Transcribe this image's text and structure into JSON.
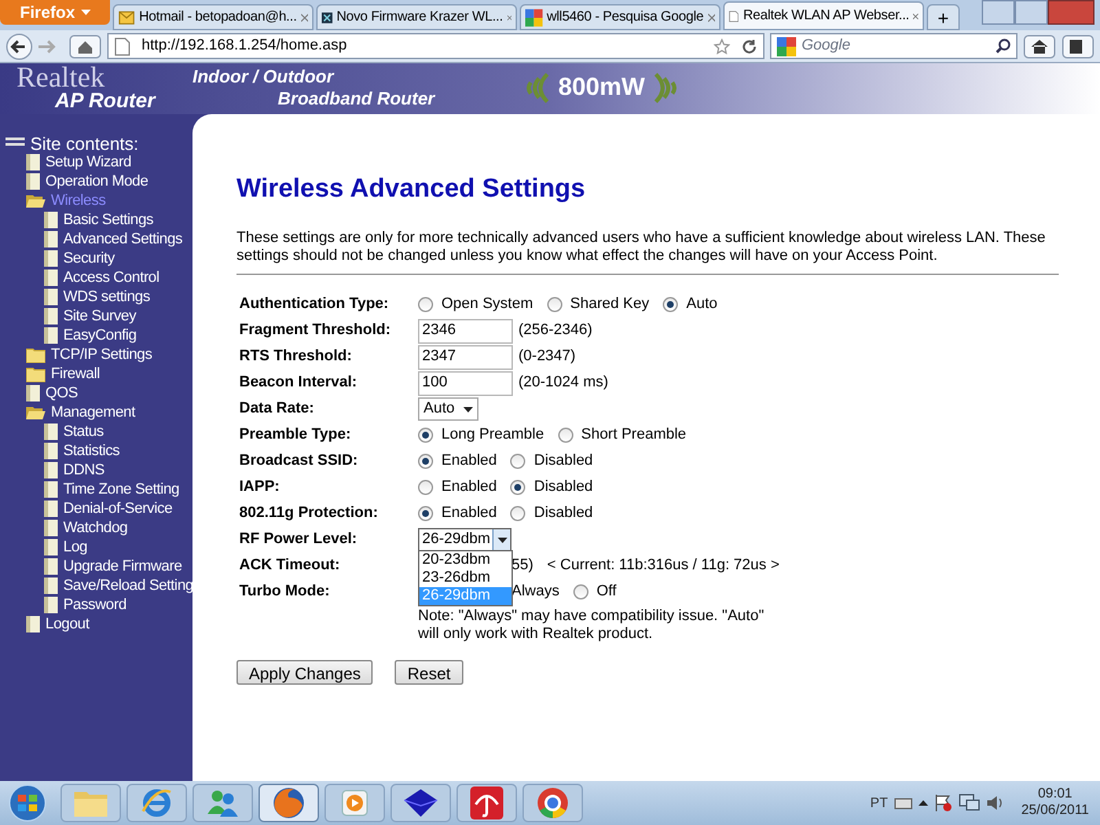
{
  "browser": {
    "menu_button": "Firefox",
    "tabs": [
      {
        "title": "Hotmail - betopadoan@h...",
        "selected": false
      },
      {
        "title": "Novo Firmware Krazer WL...",
        "selected": false
      },
      {
        "title": "wll5460 - Pesquisa Google",
        "selected": false
      },
      {
        "title": "Realtek WLAN AP Webser...",
        "selected": true
      }
    ],
    "new_tab": "+",
    "url": "http://192.168.1.254/home.asp",
    "search_placeholder": "Google"
  },
  "banner": {
    "brand": "Realtek",
    "product": "AP Router",
    "line_1": "Indoor / Outdoor",
    "line_2": "Broadband Router",
    "power": "800mW"
  },
  "sidebar": {
    "title": "Site contents:",
    "items": [
      {
        "label": "Setup Wizard",
        "kind": "page",
        "selected": false
      },
      {
        "label": "Operation Mode",
        "kind": "page",
        "selected": false
      },
      {
        "label": "Wireless",
        "kind": "folder",
        "expanded": true,
        "selected": true,
        "children": [
          {
            "label": "Basic Settings",
            "kind": "page",
            "selected": false
          },
          {
            "label": "Advanced Settings",
            "kind": "page",
            "selected": false
          },
          {
            "label": "Security",
            "kind": "page",
            "selected": false
          },
          {
            "label": "Access Control",
            "kind": "page",
            "selected": false
          },
          {
            "label": "WDS settings",
            "kind": "page",
            "selected": false
          },
          {
            "label": "Site Survey",
            "kind": "page",
            "selected": false
          },
          {
            "label": "EasyConfig",
            "kind": "page",
            "selected": false
          }
        ]
      },
      {
        "label": "TCP/IP Settings",
        "kind": "folder",
        "expanded": false,
        "selected": false
      },
      {
        "label": "Firewall",
        "kind": "folder",
        "expanded": false,
        "selected": false
      },
      {
        "label": "QOS",
        "kind": "page",
        "selected": false
      },
      {
        "label": "Management",
        "kind": "folder",
        "expanded": true,
        "selected": false,
        "children": [
          {
            "label": "Status",
            "kind": "page",
            "selected": false
          },
          {
            "label": "Statistics",
            "kind": "page",
            "selected": false
          },
          {
            "label": "DDNS",
            "kind": "page",
            "selected": false
          },
          {
            "label": "Time Zone Setting",
            "kind": "page",
            "selected": false
          },
          {
            "label": "Denial-of-Service",
            "kind": "page",
            "selected": false
          },
          {
            "label": "Watchdog",
            "kind": "page",
            "selected": false
          },
          {
            "label": "Log",
            "kind": "page",
            "selected": false
          },
          {
            "label": "Upgrade Firmware",
            "kind": "page",
            "selected": false
          },
          {
            "label": "Save/Reload Setting",
            "kind": "page",
            "selected": false
          },
          {
            "label": "Password",
            "kind": "page",
            "selected": false
          }
        ]
      },
      {
        "label": "Logout",
        "kind": "page",
        "selected": false
      }
    ]
  },
  "page": {
    "title": "Wireless Advanced Settings",
    "description": "These settings are only for more technically advanced users who have a sufficient knowledge about wireless LAN. These settings should not be changed unless you know what effect the changes will have on your Access Point.",
    "rows": [
      {
        "kind": "radio",
        "label": "Authentication Type:",
        "options": [
          {
            "label": "Open System",
            "selected": false
          },
          {
            "label": "Shared Key",
            "selected": false
          },
          {
            "label": "Auto",
            "selected": true
          }
        ]
      },
      {
        "kind": "text",
        "label": "Fragment Threshold:",
        "value": "2346",
        "hint": "(256-2346)"
      },
      {
        "kind": "text",
        "label": "RTS Threshold:",
        "value": "2347",
        "hint": "(0-2347)"
      },
      {
        "kind": "text",
        "label": "Beacon Interval:",
        "value": "100",
        "hint": "(20-1024 ms)"
      },
      {
        "kind": "select",
        "label": "Data Rate:",
        "value": "Auto"
      },
      {
        "kind": "radio",
        "label": "Preamble Type:",
        "options": [
          {
            "label": "Long Preamble",
            "selected": true
          },
          {
            "label": "Short Preamble",
            "selected": false
          }
        ]
      },
      {
        "kind": "radio",
        "label": "Broadcast SSID:",
        "options": [
          {
            "label": "Enabled",
            "selected": true
          },
          {
            "label": "Disabled",
            "selected": false
          }
        ]
      },
      {
        "kind": "radio",
        "label": "IAPP:",
        "options": [
          {
            "label": "Enabled",
            "selected": false
          },
          {
            "label": "Disabled",
            "selected": true
          }
        ]
      },
      {
        "kind": "radio",
        "label": "802.11g Protection:",
        "options": [
          {
            "label": "Enabled",
            "selected": true
          },
          {
            "label": "Disabled",
            "selected": false
          }
        ]
      },
      {
        "kind": "dropdown",
        "label": "RF Power Level:",
        "value": "26-29dbm",
        "options": [
          {
            "label": "20-23dbm",
            "selected": false
          },
          {
            "label": "23-26dbm",
            "selected": false
          },
          {
            "label": "26-29dbm",
            "selected": true
          }
        ]
      },
      {
        "kind": "text_covered",
        "label": "ACK Timeout:",
        "hint": "55)",
        "current": "< Current: 11b:316us / 11g: 72us >"
      },
      {
        "kind": "radio",
        "label": "Turbo Mode:",
        "options": [
          {
            "label": "Always"
          },
          {
            "label": "Off",
            "selected": false
          }
        ],
        "note": "Note: \"Always\" may have compatibility issue. \"Auto\" will only work with Realtek product."
      }
    ],
    "buttons": [
      "Apply Changes",
      "Reset"
    ]
  },
  "taskbar": {
    "apps": [
      {
        "active": false
      },
      {
        "active": false
      },
      {
        "active": false
      },
      {
        "active": true
      },
      {
        "active": false
      },
      {
        "active": false
      },
      {
        "active": false
      },
      {
        "active": false
      }
    ],
    "language": "PT",
    "time": "09:01",
    "date": "25/06/2011"
  }
}
